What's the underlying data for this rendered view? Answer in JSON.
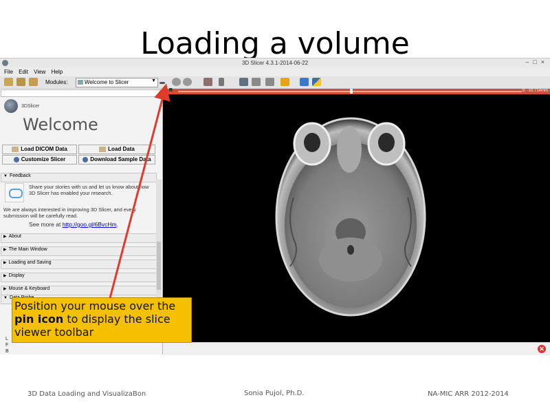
{
  "slide": {
    "title": "Loading a volume",
    "footer_left": "3D Data Loading and VisualizaBon",
    "footer_center": "Sonia Pujol, Ph.D.",
    "footer_right": "NA-MIC ARR 2012-2014"
  },
  "app": {
    "window_title": "3D Slicer 4.3.1-2014-06-22",
    "menu": [
      "File",
      "Edit",
      "View",
      "Help"
    ],
    "toolbar": {
      "modules_label": "Modules:",
      "module_selected": "Welcome to Slicer"
    }
  },
  "left_panel": {
    "logo_text": "3DSlicer",
    "heading": "Welcome",
    "buttons": {
      "load_dicom": "Load DICOM Data",
      "load_data": "Load Data",
      "customize": "Customize Slicer",
      "download_sample": "Download Sample Data"
    },
    "sections": {
      "feedback": "Feedback",
      "about": "About",
      "main_window": "The Main Window",
      "loading_saving": "Loading and Saving",
      "display": "Display",
      "mouse_keyboard": "Mouse & Keyboard",
      "data_probe": "Data Probe"
    },
    "feedback_text_1": "Share your stories with us and let us know about how 3D Slicer has enabled your research.",
    "feedback_text_2": "We are always interested in improving 3D Slicer, and every submission will be carefully read.",
    "see_more_label": "See more at",
    "see_more_link": "http://goo.gl/6BvcHm",
    "see_more_tail": ".",
    "status_letters": [
      "L",
      "F",
      "B"
    ]
  },
  "viewer": {
    "orientation_label": "R",
    "slice_value": "S: -10.714mm"
  },
  "callout": {
    "line1": "Position your mouse over the",
    "bold": "pin icon",
    "line2": " to display the slice viewer toolbar"
  },
  "colors": {
    "slice_bar": "#d84b3c",
    "callout_bg": "#f5c000",
    "arrow": "#e03a2a"
  }
}
